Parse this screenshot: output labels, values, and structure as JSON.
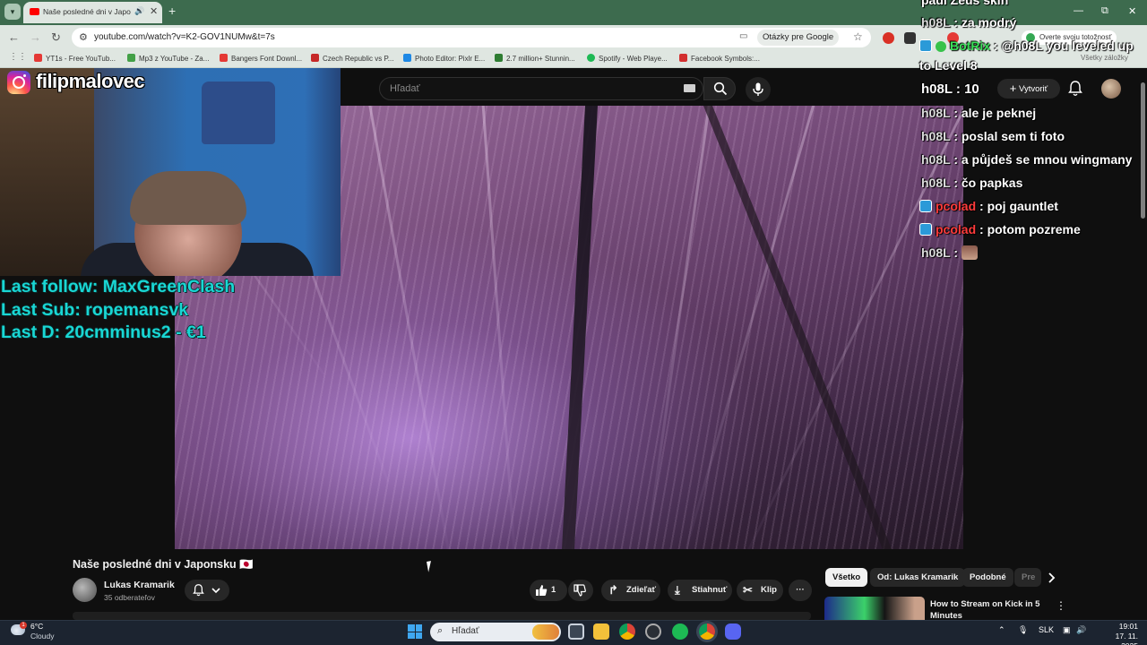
{
  "browser": {
    "tab": {
      "title": "Naše posledné dni v Japonsku",
      "close": "✕"
    },
    "new_tab": "+",
    "window_controls": {
      "minimize": "—",
      "maximize": "⧉",
      "close": "✕"
    },
    "address": {
      "url": "youtube.com/watch?v=K2-GOV1NUMw&t=7s",
      "lens_chip": "Otázky pre Google"
    },
    "profile_chip": "Overte svoju totožnosť",
    "bookmarks": [
      {
        "label": "YT1s - Free YouTub...",
        "color": "#e53935"
      },
      {
        "label": "Mp3 z YouTube - Za...",
        "color": "#43a047"
      },
      {
        "label": "Bangers Font Downl...",
        "color": "#e53935"
      },
      {
        "label": "Czech Republic vs P...",
        "color": "#c62828"
      },
      {
        "label": "Photo Editor: Pixlr E...",
        "color": "#1e88e5"
      },
      {
        "label": "2.7 million+ Stunnin...",
        "color": "#2e7d32"
      },
      {
        "label": "Spotify - Web Playe...",
        "color": "#1db954"
      },
      {
        "label": "Facebook Symbols:...",
        "color": "#d32f2f"
      }
    ],
    "all_bookmarks": "Všetky záložky"
  },
  "youtube": {
    "search_placeholder": "Hľadať",
    "create_label": "Vytvoriť",
    "video_title": "Naše posledné dni v Japonsku 🇯🇵",
    "channel": {
      "name": "Lukas Kramarik",
      "subscribers": "35 odberateľov"
    },
    "likes": "1",
    "share_label": "Zdieľať",
    "download_label": "Stiahnuť",
    "clip_label": "Klip",
    "more": "···",
    "chips": [
      "Všetko",
      "Od: Lukas Kramarik",
      "Podobné",
      "Pre"
    ],
    "recommendation": {
      "title": "How to Stream on Kick in 5 Minutes"
    }
  },
  "stream_overlay": {
    "instagram_handle": "filipmalovec",
    "last_follow": "Last follow: MaxGreenClash",
    "last_sub": "Last Sub: ropemansvk",
    "last_donation": "Last D: 20cmminus2 - €1"
  },
  "chat": [
    {
      "user": "",
      "message": "padl Zeus skin",
      "red": false,
      "icon": "none"
    },
    {
      "user": "h08L",
      "message": " : za modrý",
      "red": false,
      "icon": "none"
    },
    {
      "user": "BotRix",
      "message": " : @h08L you leveled up",
      "red": false,
      "icon": "bot"
    },
    {
      "user": "",
      "message": "to Level 8",
      "red": false,
      "icon": "none"
    },
    {
      "user": "h08L",
      "message": " : 10",
      "red": false,
      "icon": "none"
    },
    {
      "user": "h08L",
      "message": " : ale je peknej",
      "red": false,
      "icon": "none"
    },
    {
      "user": "h08L",
      "message": " : poslal sem ti foto",
      "red": false,
      "icon": "none"
    },
    {
      "user": "h08L",
      "message": " : a půjdeš se mnou wingmany",
      "red": false,
      "icon": "none"
    },
    {
      "user": "h08L",
      "message": " : čo papkas",
      "red": false,
      "icon": "none"
    },
    {
      "user": "pcolad",
      "message": " : poj gauntlet",
      "red": true,
      "icon": "sub"
    },
    {
      "user": "pcolad",
      "message": " : potom pozreme",
      "red": true,
      "icon": "sub"
    },
    {
      "user": "h08L",
      "message": " : ",
      "red": false,
      "icon": "emote"
    }
  ],
  "taskbar": {
    "weather": {
      "temp": "6°C",
      "desc": "Cloudy",
      "badge": "1"
    },
    "search_placeholder": "Hľadať",
    "language": "SLK",
    "time": "19:01",
    "date": "17. 11. 2025"
  }
}
